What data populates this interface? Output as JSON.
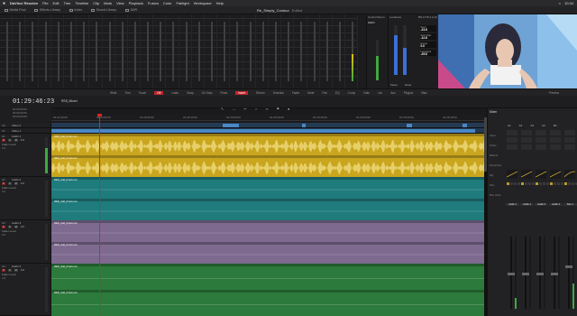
{
  "menubar": {
    "app_name": "DaVinci Resolve",
    "items": [
      "File",
      "Edit",
      "Trim",
      "Timeline",
      "Clip",
      "Mark",
      "View",
      "Playback",
      "Fusion",
      "Color",
      "Fairlight",
      "Workspace",
      "Help"
    ],
    "status_right": [
      "10:34"
    ]
  },
  "toolbar": {
    "items": [
      {
        "icon": "media-pool-icon",
        "label": "Media Pool"
      },
      {
        "icon": "effects-library-icon",
        "label": "Effects Library"
      },
      {
        "icon": "index-icon",
        "label": "Index"
      },
      {
        "icon": "sound-library-icon",
        "label": "Sound Library"
      },
      {
        "icon": "adr-icon",
        "label": "ADR"
      }
    ],
    "project_title": "Re_Simply_Contour",
    "project_status": "Edited"
  },
  "meters": {
    "levels": [
      0.0,
      0.0,
      0.0,
      0.0,
      0.0,
      0.0,
      0.0,
      0.0,
      0.0,
      0.0,
      0.0,
      0.0,
      0.0,
      0.0,
      0.0,
      0.0,
      0.0,
      0.0,
      0.0,
      0.0,
      0.0,
      0.0,
      0.0,
      0.0,
      0.0,
      0.0,
      0.0,
      0.45
    ]
  },
  "control_room": {
    "title": "Control Room",
    "mode": "MAIN"
  },
  "loudness": {
    "title": "Loudness",
    "standard": "BS.1770-1 (LU)",
    "levels": [
      0.8,
      0.55
    ],
    "readings": [
      {
        "label": "Short",
        "value": "-23.6"
      },
      {
        "label": "Short Max",
        "value": "-12.8"
      },
      {
        "label": "Range",
        "value": "0.0"
      },
      {
        "label": "Integrated",
        "value": "-25.6"
      }
    ],
    "buttons": [
      "Pause",
      "Reset"
    ]
  },
  "automation": {
    "items": [
      "Write",
      "Trim",
      "Touch",
      "Off",
      "Latch",
      "Snap",
      "On Stop",
      "Fixed",
      "Insert",
      "Return",
      "Overdub",
      "Fader",
      "Mute",
      "Pan",
      "EQ",
      "Comp",
      "Gate",
      "Lim",
      "Aux",
      "Plugins",
      "Misc"
    ],
    "active": [
      "Off",
      "Insert"
    ],
    "preview_label": "Preview"
  },
  "timeline_header": {
    "timecode": "01:29:46:23",
    "timeline_name": "RE8_Mixed",
    "tc_info": [
      "00:00:00:00",
      "00:00:00:00",
      "00:00:00:00"
    ],
    "ruler_labels": [
      "01:24:40:00",
      "01:24:50:00",
      "01:25:00:00",
      "01:25:10:00",
      "01:25:20:00",
      "01:25:30:00",
      "01:25:40:00",
      "01:25:50:00",
      "01:26:00:00",
      "01:26:10:00"
    ]
  },
  "tracks": [
    {
      "id": "V2",
      "name": "Video 2",
      "type": "video"
    },
    {
      "id": "V1",
      "name": "Video 1",
      "type": "video"
    },
    {
      "id": "A1",
      "name": "Audio 1",
      "type": "audio",
      "fader_label": "Fader Level",
      "fader_value": "0.0",
      "format": "2.0",
      "color": "#c9a61e",
      "clip_name": "RE8_Add_Final.mov"
    },
    {
      "id": "A2",
      "name": "Audio 2",
      "type": "audio",
      "fader_label": "Fader Level",
      "fader_value": "0.0",
      "format": "2.0",
      "color": "#1f7b7c",
      "clip_name": "RE8_Add_Final.mov"
    },
    {
      "id": "A3",
      "name": "Audio 3",
      "type": "audio",
      "fader_label": "Fader Level",
      "fader_value": "0.0",
      "format": "2.0",
      "color": "#7d6a8e",
      "clip_name": "RE8_Add_Final.mov"
    },
    {
      "id": "A4",
      "name": "Audio 4",
      "type": "audio",
      "fader_label": "Fader Level",
      "fader_value": "0.0",
      "format": "2.0",
      "color": "#2c7a3c",
      "clip_name": "RE8_Add_Final.mov"
    }
  ],
  "mixer": {
    "title": "Mixer",
    "columns": [
      "A1",
      "A2",
      "A3",
      "A4",
      "M1"
    ],
    "row_labels": [
      "Input",
      "Order",
      "Effects",
      "Dynamics",
      "EQ",
      "Pan",
      "Bus Outs"
    ],
    "strip_labels": [
      "Audio 1",
      "Audio 2",
      "Audio 3",
      "Audio 4",
      "Bus 1"
    ],
    "fader_levels": [
      0.5,
      0.5,
      0.5,
      0.5,
      0.6
    ],
    "meter_levels": [
      0.15,
      0.0,
      0.0,
      0.0,
      0.35
    ]
  }
}
